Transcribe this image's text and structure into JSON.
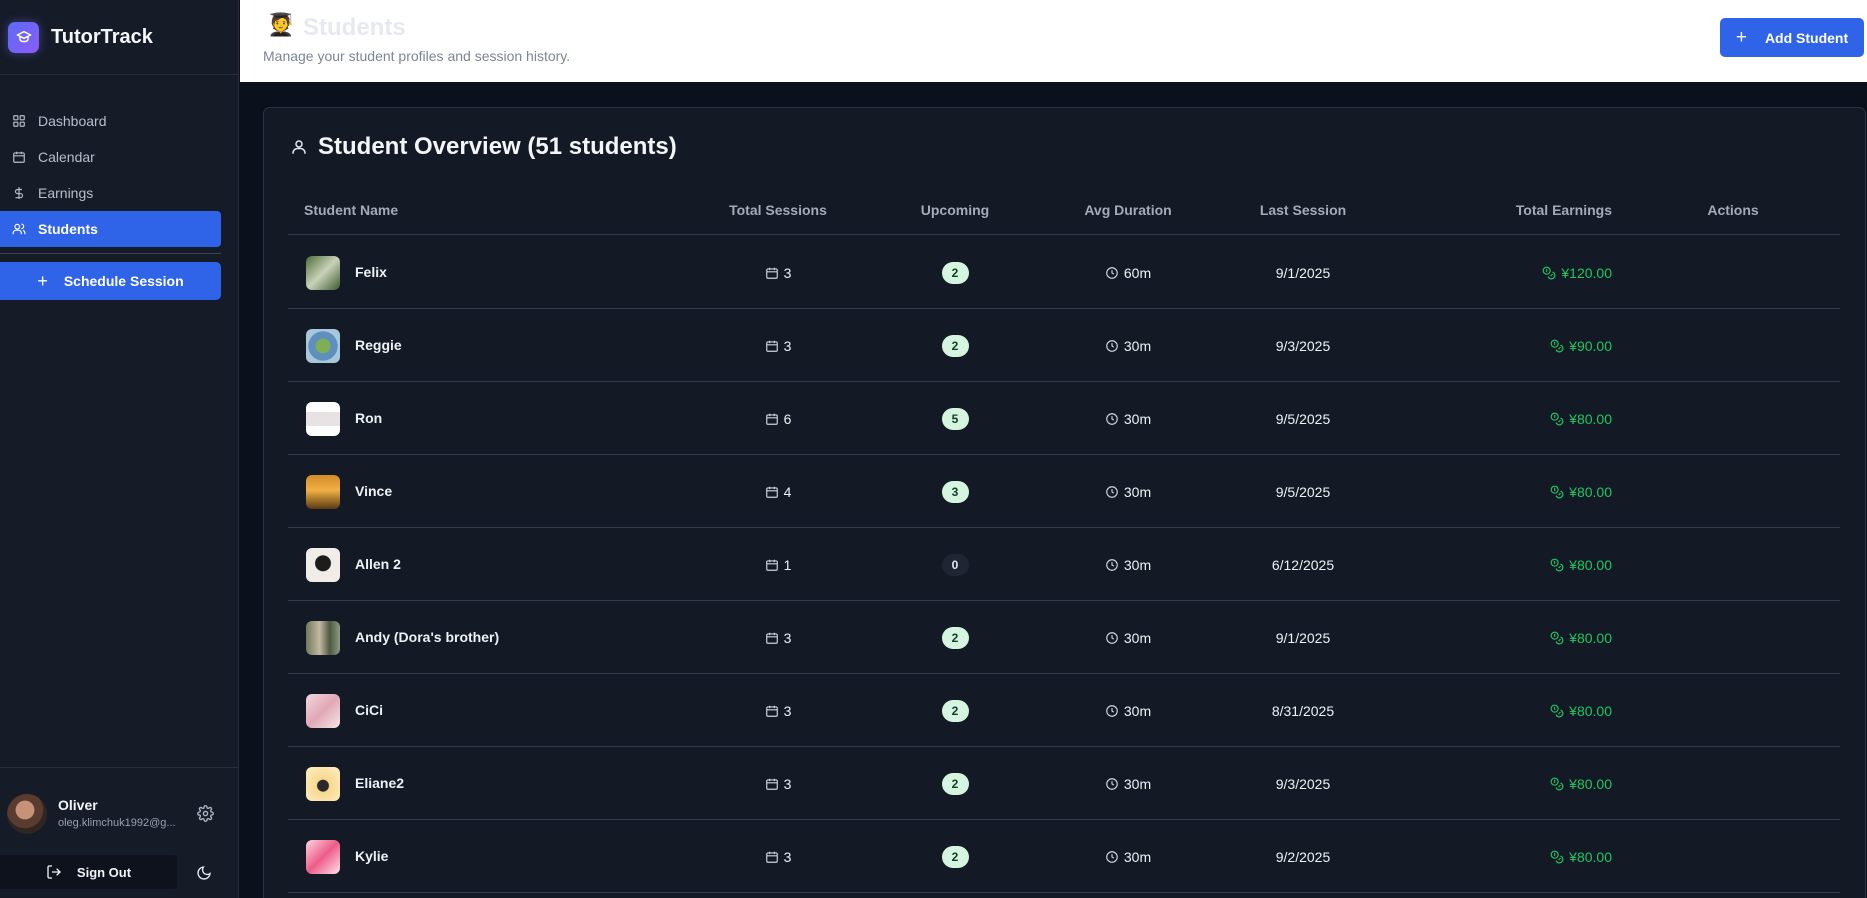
{
  "app": {
    "name": "TutorTrack"
  },
  "sidebar": {
    "nav": [
      {
        "label": "Dashboard",
        "icon": "grid-icon"
      },
      {
        "label": "Calendar",
        "icon": "calendar-icon"
      },
      {
        "label": "Earnings",
        "icon": "dollar-icon"
      },
      {
        "label": "Students",
        "icon": "users-icon",
        "active": true
      }
    ],
    "schedule_label": "Schedule Session",
    "user": {
      "name": "Oliver",
      "email": "oleg.klimchuk1992@g..."
    },
    "signout_label": "Sign Out"
  },
  "header": {
    "emoji": "🧑‍🎓",
    "title": "Students",
    "subtitle": "Manage your student profiles and session history.",
    "add_label": "Add Student"
  },
  "overview": {
    "title": "Student Overview (51 students)",
    "columns": [
      "Student Name",
      "Total Sessions",
      "Upcoming",
      "Avg Duration",
      "Last Session",
      "Total Earnings",
      "Actions"
    ],
    "rows": [
      {
        "name": "Felix",
        "sessions": "3",
        "upcoming": "2",
        "duration": "60m",
        "last": "9/1/2025",
        "earnings": "¥120.00"
      },
      {
        "name": "Reggie",
        "sessions": "3",
        "upcoming": "2",
        "duration": "30m",
        "last": "9/3/2025",
        "earnings": "¥90.00"
      },
      {
        "name": "Ron",
        "sessions": "6",
        "upcoming": "5",
        "duration": "30m",
        "last": "9/5/2025",
        "earnings": "¥80.00"
      },
      {
        "name": "Vince",
        "sessions": "4",
        "upcoming": "3",
        "duration": "30m",
        "last": "9/5/2025",
        "earnings": "¥80.00"
      },
      {
        "name": "Allen 2",
        "sessions": "1",
        "upcoming": "0",
        "duration": "30m",
        "last": "6/12/2025",
        "earnings": "¥80.00"
      },
      {
        "name": "Andy (Dora's brother)",
        "sessions": "3",
        "upcoming": "2",
        "duration": "30m",
        "last": "9/1/2025",
        "earnings": "¥80.00"
      },
      {
        "name": "CiCi",
        "sessions": "3",
        "upcoming": "2",
        "duration": "30m",
        "last": "8/31/2025",
        "earnings": "¥80.00"
      },
      {
        "name": "Eliane2",
        "sessions": "3",
        "upcoming": "2",
        "duration": "30m",
        "last": "9/3/2025",
        "earnings": "¥80.00"
      },
      {
        "name": "Kylie",
        "sessions": "3",
        "upcoming": "2",
        "duration": "30m",
        "last": "9/2/2025",
        "earnings": "¥80.00"
      }
    ]
  },
  "colors": {
    "accent": "#2f63e8",
    "earnings": "#22c55e",
    "badge_bg": "#d5f5e1"
  }
}
